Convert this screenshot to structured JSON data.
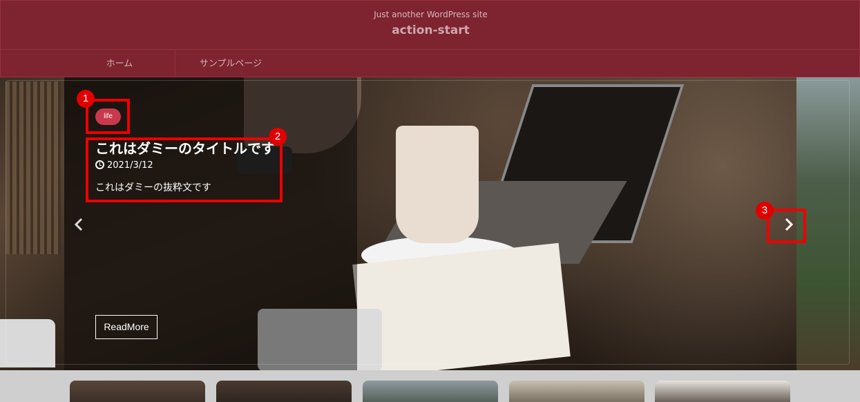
{
  "header": {
    "tagline": "Just another WordPress site",
    "site_title": "action-start"
  },
  "nav": {
    "items": [
      {
        "label": "ホーム"
      },
      {
        "label": "サンプルページ"
      }
    ]
  },
  "slider": {
    "category_badge": "life",
    "title": "これはダミーのタイトルです",
    "date": "2021/3/12",
    "excerpt": "これはダミーの抜粋文です",
    "readmore_label": "ReadMore",
    "prev_icon": "chevron-left-icon",
    "next_icon": "chevron-right-icon"
  },
  "annotations": [
    {
      "number": "1"
    },
    {
      "number": "2"
    },
    {
      "number": "3"
    }
  ],
  "colors": {
    "header_bg": "#7e2330",
    "badge_bg": "#c9384b",
    "annotation_red": "#ee0000"
  }
}
